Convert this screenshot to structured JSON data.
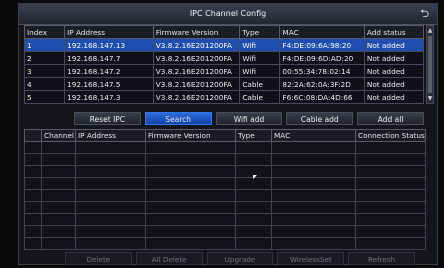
{
  "window": {
    "title": "IPC Channel Config",
    "back_icon": "return-arrow-icon"
  },
  "top_table": {
    "headers": [
      "Index",
      "IP Address",
      "Firmware Version",
      "Type",
      "MAC",
      "Add status"
    ],
    "rows": [
      [
        "1",
        "192.168.147.13",
        "V3.8.2.16E201200FA",
        "Wifi",
        "F4:DE:09:6A:98:20",
        "Not added"
      ],
      [
        "2",
        "192.168.147.7",
        "V3.8.2.16E201200FA",
        "Wifi",
        "F4:DE:09:6D:AD:20",
        "Not added"
      ],
      [
        "3",
        "192.168.147.2",
        "V3.8.2.16E201200FA",
        "Wifi",
        "00:55:34:78:02:14",
        "Not added"
      ],
      [
        "4",
        "192.168.147.5",
        "V3.8.2.16E201200FA",
        "Cable",
        "82:2A:62:0A:3F:2D",
        "Not added"
      ],
      [
        "5",
        "192.168.147.3",
        "V3.8.2.16E201200FA",
        "Cable",
        "F6:6C:08:DA:4D:66",
        "Not added"
      ]
    ]
  },
  "actions": [
    "Reset IPC",
    "Search",
    "Wifi add",
    "Cable add",
    "Add all"
  ],
  "bottom_table": {
    "headers": [
      "Channel",
      "IP Address",
      "Firmware Version",
      "Type",
      "MAC",
      "Connection Status"
    ]
  },
  "footer": [
    "Delete",
    "All Delete",
    "Upgrade",
    "WirelessSet",
    "Refresh"
  ],
  "colors": {
    "selected_row": "#1e4fb0",
    "active_button": "#1e5bd0"
  }
}
